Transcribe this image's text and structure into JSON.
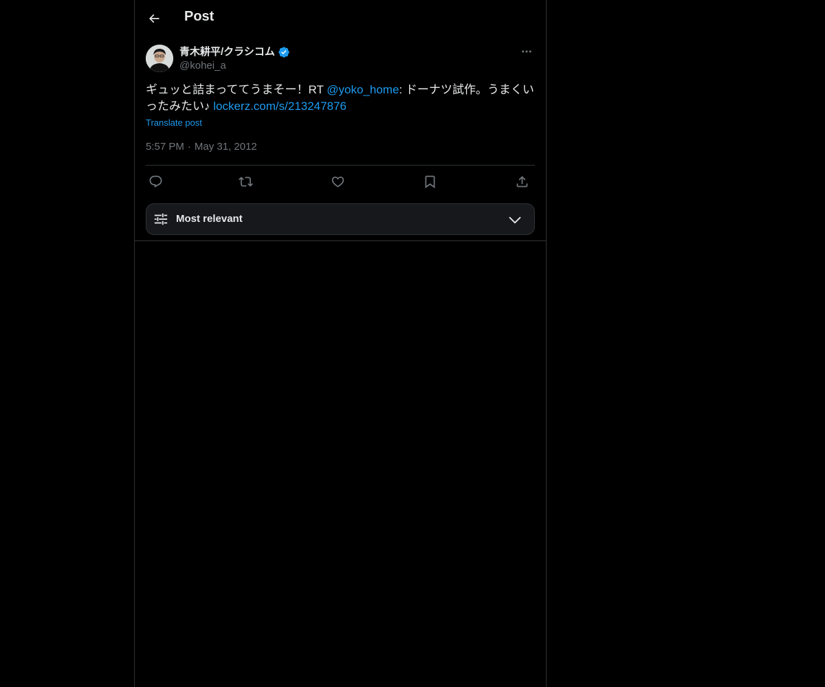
{
  "header": {
    "title": "Post",
    "back_icon": "arrow-left-icon"
  },
  "author": {
    "display_name": "青木耕平/クラシコム",
    "handle": "@kohei_a",
    "verified": true,
    "verified_color": "#1d9bf0",
    "more_icon": "more-horizontal-icon"
  },
  "tweet": {
    "text_part1": "ギュッと詰まっててうまそー！RT ",
    "mention": "@yoko_home",
    "text_part2": ": ドーナツ試作。うまくいったみたい♪ ",
    "link": "lockerz.com/s/213247876",
    "translate_label": "Translate post",
    "time": "5:57 PM",
    "separator": "·",
    "date": "May 31, 2012"
  },
  "actions": [
    {
      "name": "reply",
      "icon": "reply-icon"
    },
    {
      "name": "repost",
      "icon": "repost-icon"
    },
    {
      "name": "like",
      "icon": "heart-icon"
    },
    {
      "name": "bookmark",
      "icon": "bookmark-icon"
    },
    {
      "name": "share",
      "icon": "share-icon"
    }
  ],
  "sort": {
    "label": "Most relevant",
    "icon": "sliders-icon",
    "chevron": "chevron-down-icon"
  },
  "colors": {
    "background": "#000000",
    "text": "#e7e9ea",
    "muted": "#71767b",
    "accent": "#1d9bf0",
    "border": "#2f3336"
  }
}
